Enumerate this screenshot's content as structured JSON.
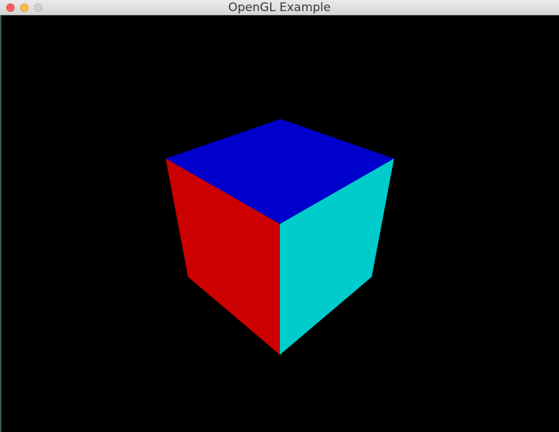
{
  "window": {
    "title": "OpenGL Example"
  },
  "controls": {
    "close_icon": "close-icon",
    "minimize_icon": "minimize-icon",
    "zoom_icon": "zoom-icon"
  },
  "scene": {
    "background_color": "#000000",
    "cube": {
      "top_face_color": "#0000cc",
      "left_face_color": "#cc0000",
      "right_face_color": "#00cccc"
    }
  }
}
